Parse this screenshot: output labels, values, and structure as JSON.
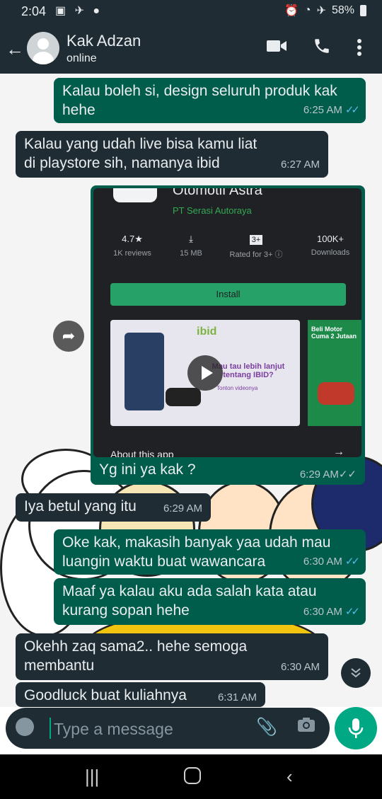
{
  "status_bar": {
    "time": "2:04",
    "battery": "58%"
  },
  "header": {
    "contact_name": "Kak Adzan",
    "contact_status": "online"
  },
  "messages": [
    {
      "dir": "out",
      "text": "Kalau boleh si, design seluruh produk kak hehe",
      "time": "6:25 AM"
    },
    {
      "dir": "in",
      "text": "Kalau yang udah live bisa kamu liat di playstore sih, namanya ibid",
      "time": "6:27 AM"
    },
    {
      "dir": "out",
      "text": "Yg ini ya kak ?",
      "time": "6:29 AM"
    },
    {
      "dir": "in",
      "text": "Iya betul yang itu",
      "time": "6:29 AM"
    },
    {
      "dir": "out",
      "text": "Oke kak, makasih banyak yaa udah mau luangin waktu buat wawancara",
      "time": "6:30 AM"
    },
    {
      "dir": "out",
      "text": "Maaf ya kalau aku ada salah kata atau kurang sopan hehe",
      "time": "6:30 AM"
    },
    {
      "dir": "in",
      "text": "Okehh zaq sama2.. hehe semoga membantu",
      "time": "6:30 AM"
    },
    {
      "dir": "in",
      "text": "Goodluck buat kuliahnya",
      "time": "6:31 AM"
    }
  ],
  "playstore": {
    "title": "Otomotif Astra",
    "developer": "PT Serasi Autoraya",
    "rating": "4.7★",
    "reviews": "1K reviews",
    "size": "15 MB",
    "content_rating_icon": "3+",
    "content_rating": "Rated for 3+ ⓘ",
    "downloads": "100K+",
    "downloads_label": "Downloads",
    "install_label": "Install",
    "video_brand": "ibid",
    "video_text": "Mau tau lebih lanjut tentang IBID?",
    "video_sub": "Tonton videonya",
    "promo_text": "Beli Motor Cuma 2 Jutaan",
    "about_label": "About this app",
    "colors": {
      "background": "#202124",
      "install": "#26a269",
      "developer": "#34a853"
    }
  },
  "input": {
    "placeholder": "Type a message"
  },
  "colors": {
    "outgoing": "#005c4b",
    "incoming": "#1f2c34",
    "accent": "#00a884",
    "tick_read": "#53bdeb"
  }
}
